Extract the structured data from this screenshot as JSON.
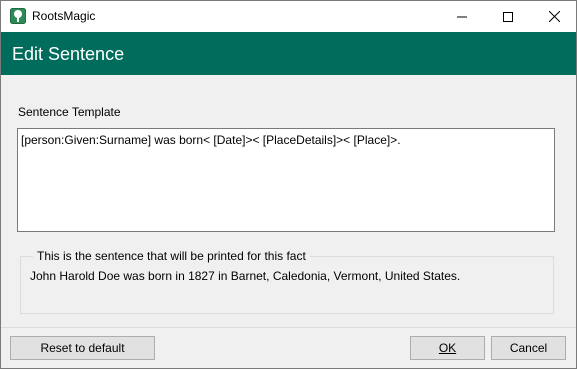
{
  "window": {
    "app_title": "RootsMagic",
    "accent_color": "#006c5b"
  },
  "header": {
    "title": "Edit Sentence"
  },
  "template": {
    "label": "Sentence Template",
    "value": "[person:Given:Surname] was born< [Date]>< [PlaceDetails]>< [Place]>."
  },
  "preview": {
    "caption": "This is the sentence that will be printed for this fact",
    "text": "John Harold Doe was born in 1827 in Barnet, Caledonia, Vermont, United States."
  },
  "buttons": {
    "reset_label": "Reset to default",
    "ok_label": "OK",
    "cancel_label": "Cancel"
  }
}
